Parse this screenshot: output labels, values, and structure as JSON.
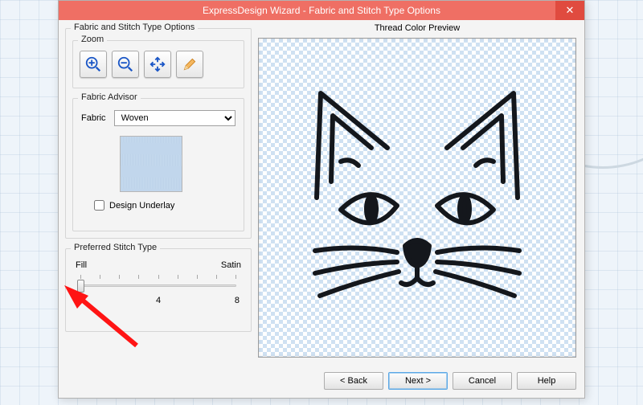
{
  "dialog": {
    "title": "ExpressDesign Wizard - Fabric and Stitch Type Options",
    "close_glyph": "✕"
  },
  "outer": {
    "legend": "Fabric and Stitch Type Options"
  },
  "zoom": {
    "legend": "Zoom"
  },
  "advisor": {
    "legend": "Fabric Advisor",
    "fabric_label": "Fabric",
    "fabric_value": "Woven",
    "underlay_label": "Design Underlay"
  },
  "stitch": {
    "legend": "Preferred Stitch Type",
    "left_label": "Fill",
    "right_label": "Satin",
    "num0": "0",
    "num4": "4",
    "num8": "8"
  },
  "preview": {
    "label": "Thread Color Preview"
  },
  "buttons": {
    "back": "< Back",
    "next": "Next >",
    "cancel": "Cancel",
    "help": "Help"
  }
}
